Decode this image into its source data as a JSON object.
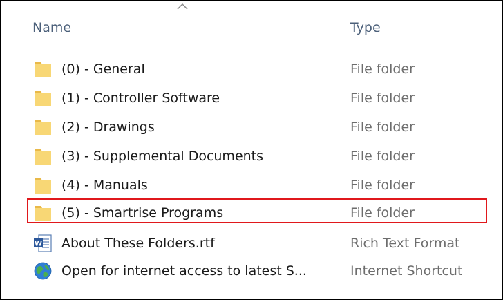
{
  "header": {
    "name_label": "Name",
    "type_label": "Type",
    "sort_icon": "chevron-up-icon"
  },
  "rows": [
    {
      "name": "(0) - General",
      "type": "File folder",
      "icon": "folder-icon"
    },
    {
      "name": "(1) - Controller Software",
      "type": "File folder",
      "icon": "folder-icon"
    },
    {
      "name": "(2) - Drawings",
      "type": "File folder",
      "icon": "folder-icon"
    },
    {
      "name": "(3) - Supplemental Documents",
      "type": "File folder",
      "icon": "folder-icon"
    },
    {
      "name": "(4) - Manuals",
      "type": "File folder",
      "icon": "folder-icon"
    },
    {
      "name": "(5) - Smartrise Programs",
      "type": "File folder",
      "icon": "folder-icon",
      "highlighted": true
    },
    {
      "name": "About These Folders.rtf",
      "type": "Rich Text Format",
      "icon": "word-document-icon"
    },
    {
      "name": "Open for internet access to latest S...",
      "type": "Internet Shortcut",
      "icon": "globe-icon"
    }
  ],
  "colors": {
    "folder": "#f8d775",
    "folder_dark": "#e9b949",
    "highlight_border": "#e0181c",
    "header_text": "#4c607a",
    "type_text": "#6d6d6d"
  }
}
